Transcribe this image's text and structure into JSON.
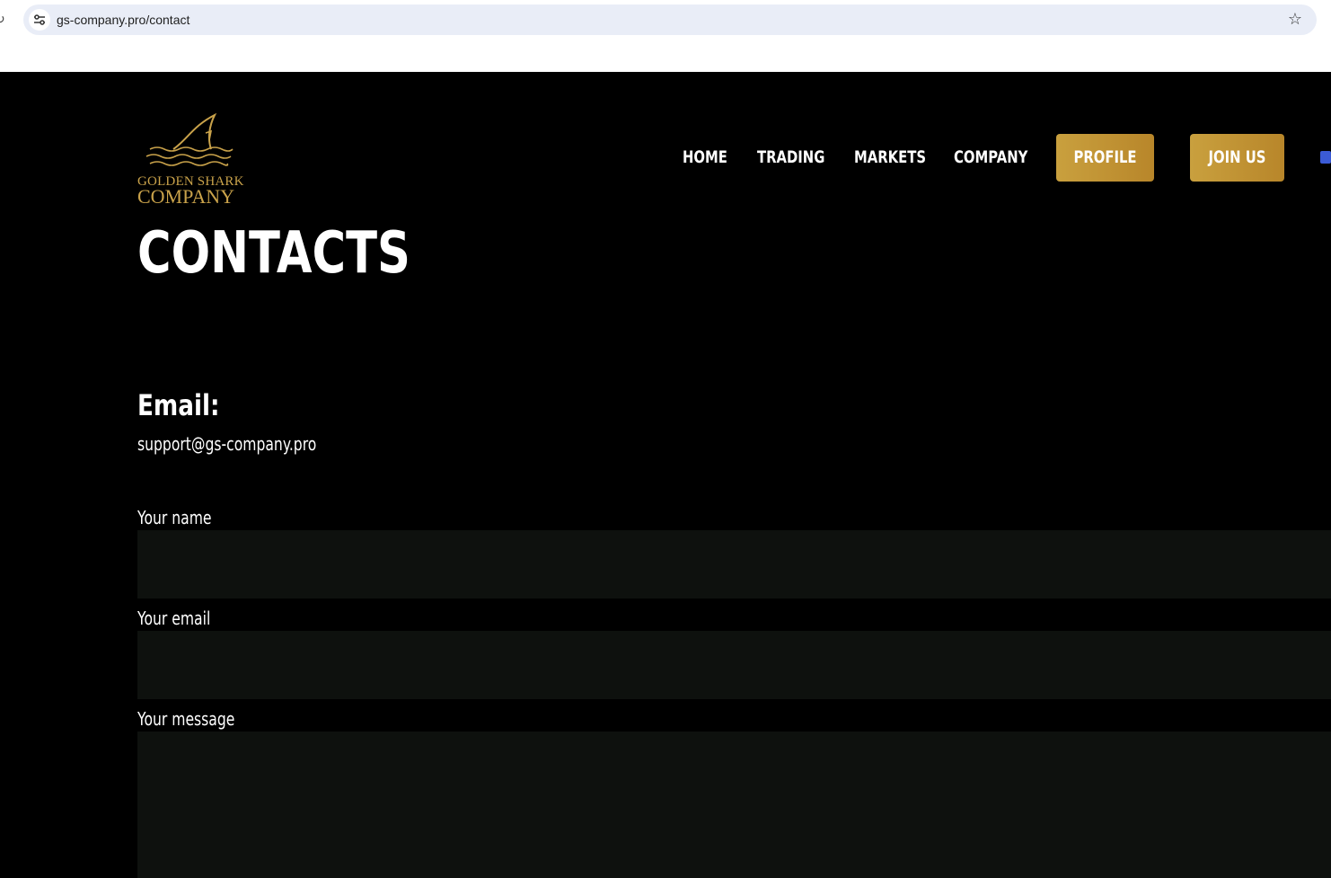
{
  "browser": {
    "url": "gs-company.pro/contact"
  },
  "logo": {
    "line1": "GOLDEN SHARK",
    "line2": "COMPANY",
    "color": "#c9a24a"
  },
  "nav": {
    "links": [
      "HOME",
      "TRADING",
      "MARKETS",
      "COMPANY"
    ],
    "profile_label": "PROFILE",
    "join_label": "JOIN US",
    "button_color": "#c19533"
  },
  "page": {
    "title": "CONTACTS",
    "email_heading": "Email:",
    "email_value": "support@gs-company.pro"
  },
  "form": {
    "name_label": "Your name",
    "email_label": "Your email",
    "message_label": "Your message",
    "field_bg": "#0e110e"
  }
}
